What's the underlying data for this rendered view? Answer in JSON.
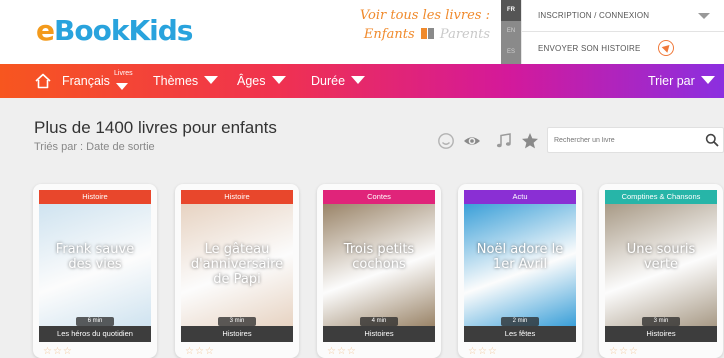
{
  "header": {
    "logo": {
      "e": "e",
      "book": "Book",
      "kids": "Kids"
    },
    "voir_line1": "Voir tous les livres :",
    "voir_enfants": "Enfants",
    "voir_parents": "Parents",
    "languages": [
      {
        "code": "FR",
        "active": true
      },
      {
        "code": "EN",
        "active": false
      },
      {
        "code": "ES",
        "active": false
      }
    ],
    "account": {
      "login_label": "INSCRIPTION / CONNEXION",
      "send_story_label": "ENVOYER SON HISTOIRE"
    }
  },
  "nav": {
    "home_icon": "home-icon",
    "items": [
      {
        "label": "Français",
        "tag": "Livres"
      },
      {
        "label": "Thèmes"
      },
      {
        "label": "Âges"
      },
      {
        "label": "Durée"
      }
    ],
    "sort_label": "Trier par"
  },
  "main": {
    "title": "Plus de 1400 livres pour enfants",
    "subtitle": "Triés par : Date de sortie",
    "filter_icons": [
      "smiley-icon",
      "eye-icon",
      "music-note-icon",
      "star-icon"
    ],
    "search": {
      "placeholder": "Rechercher un livre"
    }
  },
  "cards": [
    {
      "category": "Histoire",
      "category_color": "#e8472c",
      "title": "Frank sauve des vies",
      "duration": "6 min",
      "subtitle": "Les héros du quotidien",
      "cover_color": "#cfe3f0"
    },
    {
      "category": "Histoire",
      "category_color": "#e8472c",
      "title": "Le gâteau d'anniversaire de Papi",
      "duration": "3 min",
      "subtitle": "Histoires",
      "cover_color": "#e7d3c2"
    },
    {
      "category": "Contes",
      "category_color": "#e0247a",
      "title": "Trois petits cochons",
      "duration": "4 min",
      "subtitle": "Histoires",
      "cover_color": "#9a8468"
    },
    {
      "category": "Actu",
      "category_color": "#8a2fd4",
      "title": "Noël adore le 1er Avril",
      "duration": "2 min",
      "subtitle": "Les fêtes",
      "cover_color": "#3a9fd8"
    },
    {
      "category": "Comptines & Chansons",
      "category_color": "#27b5a8",
      "title": "Une souris verte",
      "duration": "3 min",
      "subtitle": "Histoires",
      "cover_color": "#a89a86"
    }
  ]
}
